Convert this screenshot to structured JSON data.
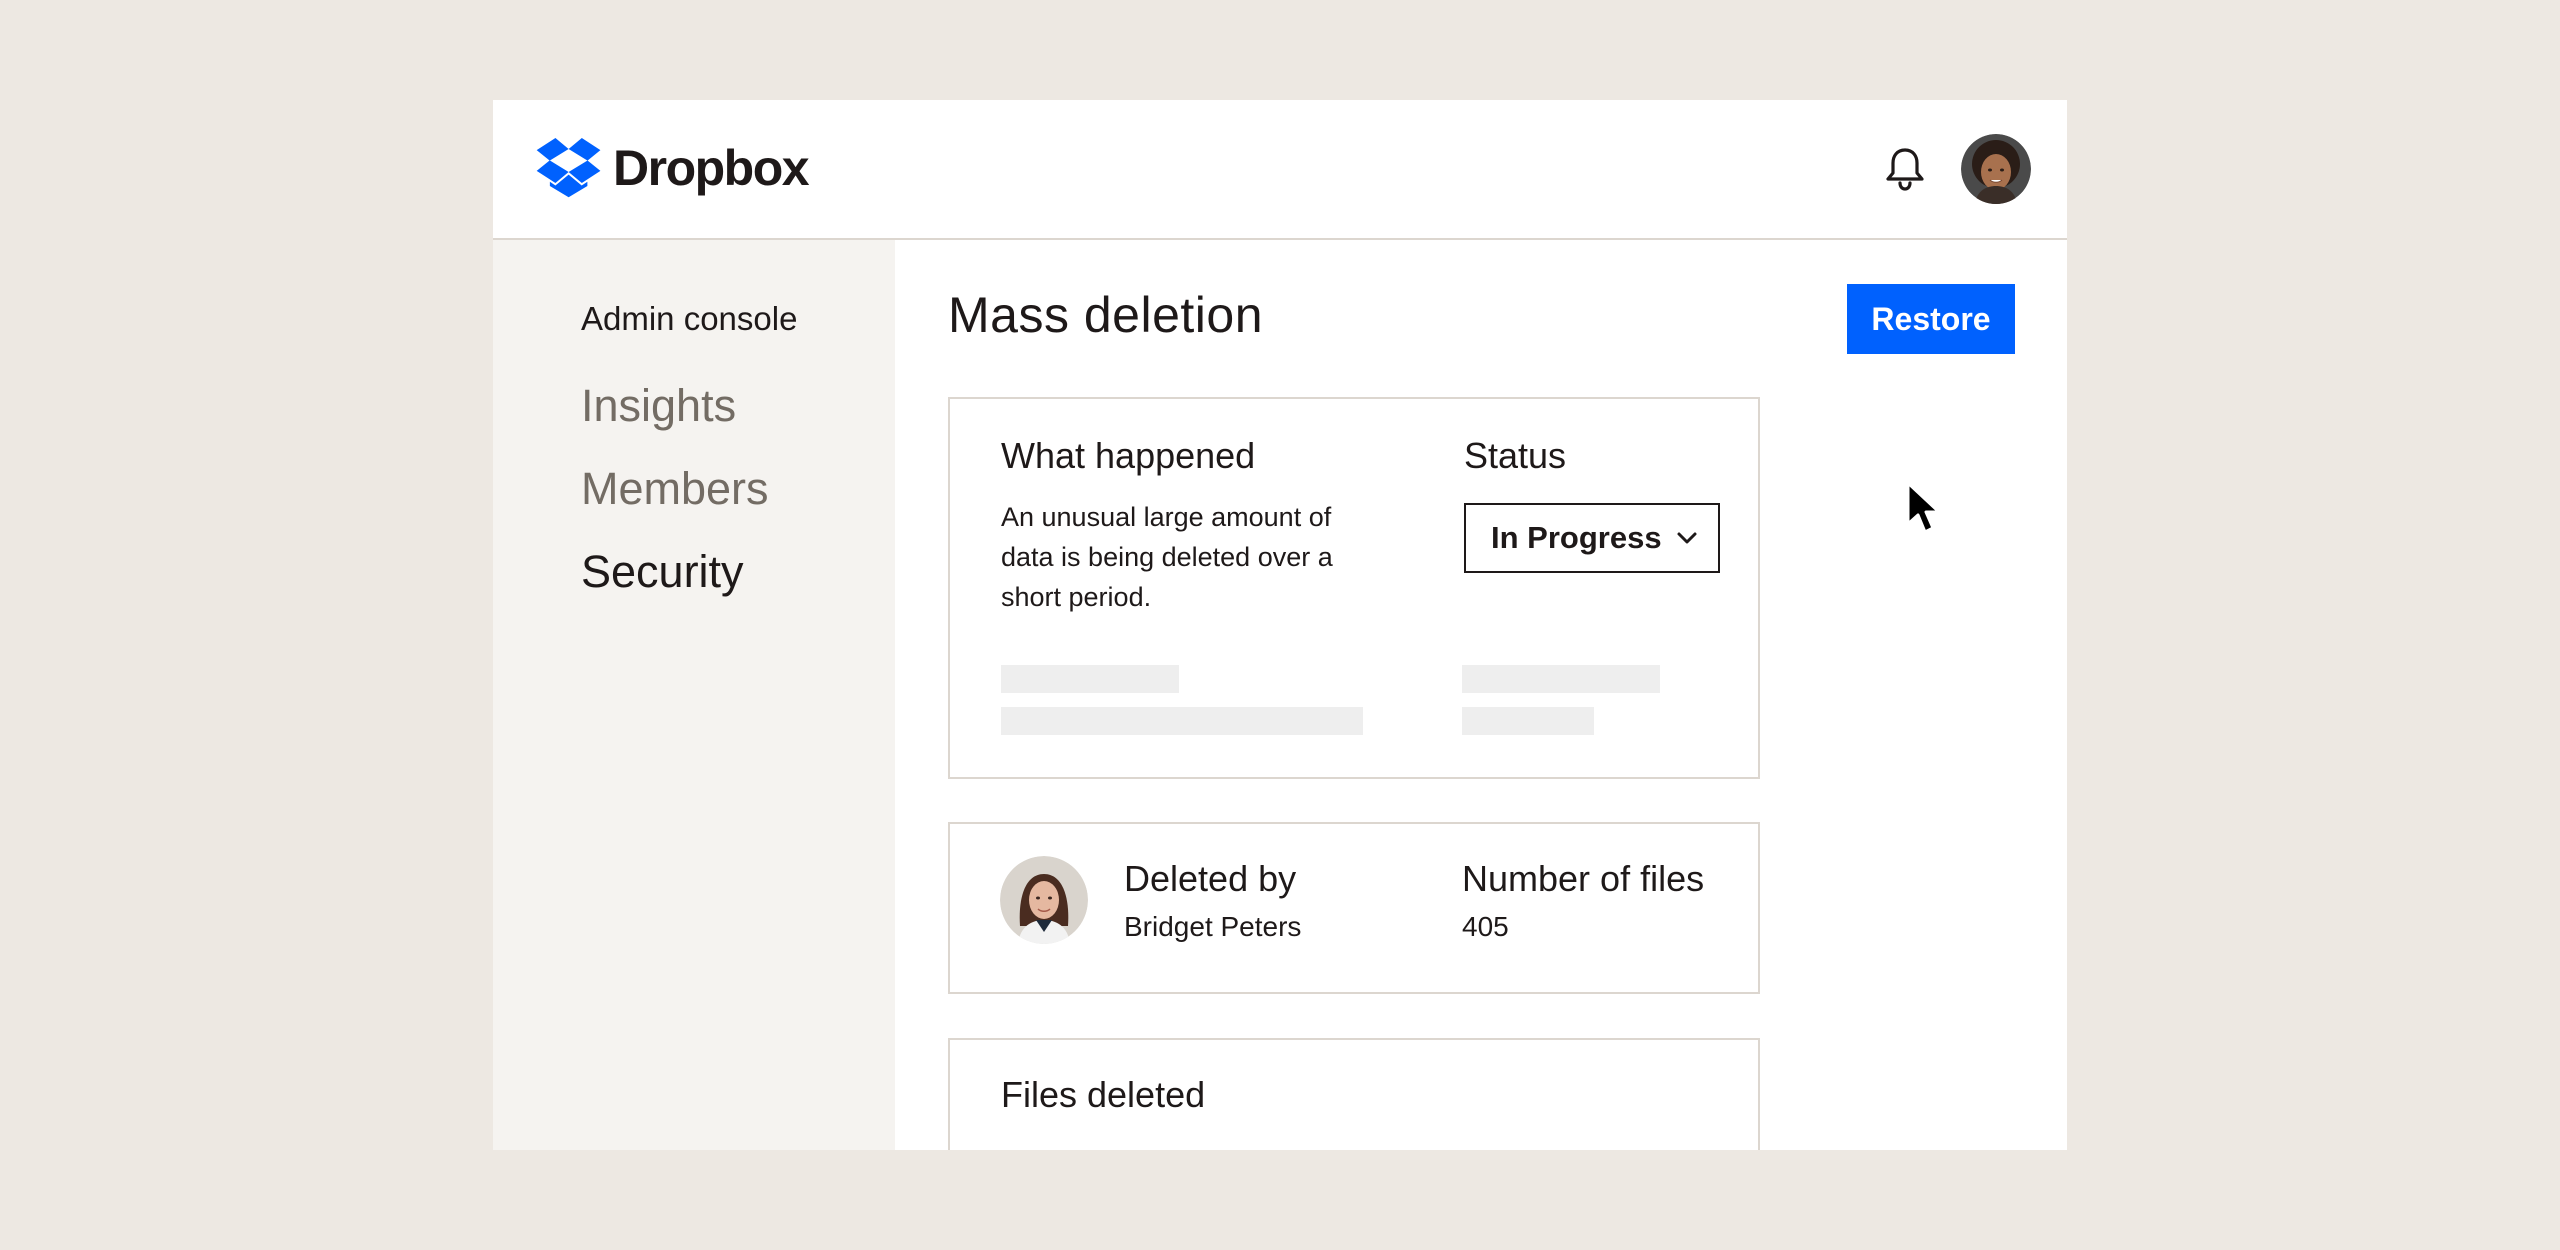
{
  "app": {
    "brand": "Dropbox",
    "brand_color": "#0061fe"
  },
  "header": {
    "notification_icon": "bell-icon",
    "avatar": "user-avatar"
  },
  "sidebar": {
    "heading": "Admin console",
    "items": [
      {
        "label": "Insights",
        "active": false
      },
      {
        "label": "Members",
        "active": false
      },
      {
        "label": "Security",
        "active": true
      }
    ]
  },
  "main": {
    "title": "Mass deletion",
    "restore_label": "Restore",
    "incident_card": {
      "what_happened_label": "What happened",
      "description": "An unusual large amount of data is being deleted over a short period.",
      "status_label": "Status",
      "status_value": "In Progress"
    },
    "details_card": {
      "deleted_by_label": "Deleted by",
      "deleted_by_value": "Bridget Peters",
      "files_count_label": "Number of files",
      "files_count_value": "405"
    },
    "files_card": {
      "title": "Files deleted"
    }
  },
  "colors": {
    "background": "#ede8e2",
    "sidebar": "#f5f3f0",
    "border": "#dcd6cf",
    "primary": "#0061fe",
    "text": "#1e1919",
    "muted_text": "#736c64"
  }
}
